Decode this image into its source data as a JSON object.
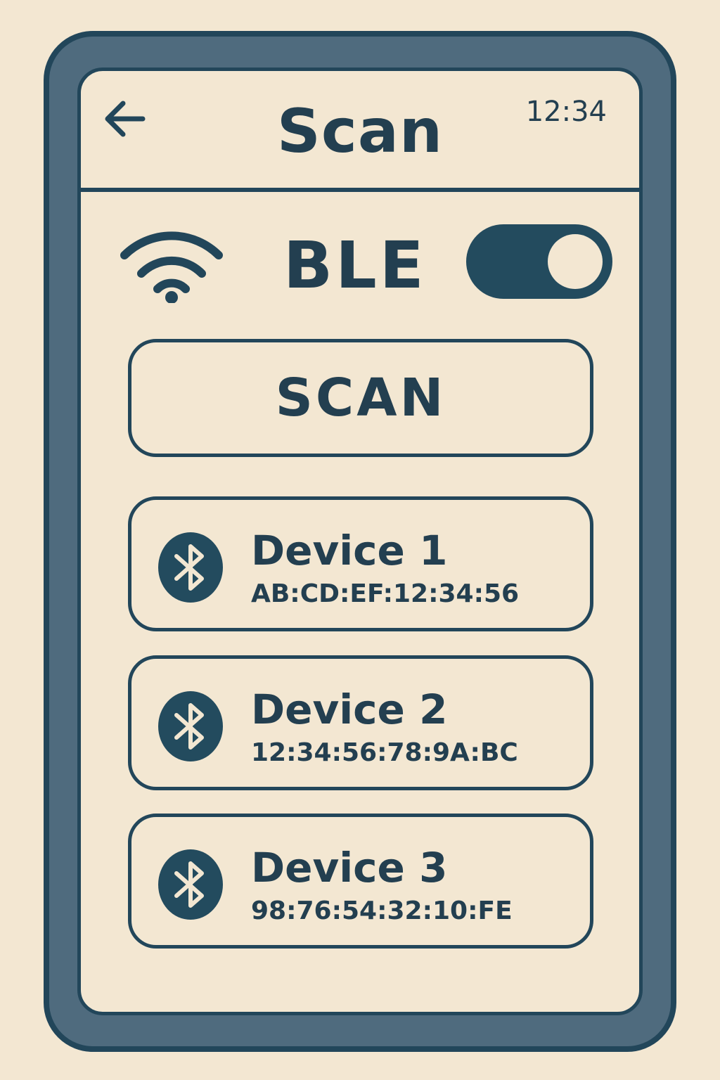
{
  "header": {
    "title": "Scan",
    "time": "12:34",
    "back_icon": "arrow-left-icon"
  },
  "ble": {
    "label": "BLE",
    "toggle_on": true,
    "icon": "wifi-icon"
  },
  "scan_button": {
    "label": "SCAN"
  },
  "devices": [
    {
      "name": "Device 1",
      "address": "AB:CD:EF:12:34:56",
      "icon": "bluetooth-icon"
    },
    {
      "name": "Device 2",
      "address": "12:34:56:78:9A:BC",
      "icon": "bluetooth-icon"
    },
    {
      "name": "Device 3",
      "address": "98:76:54:32:10:FE",
      "icon": "bluetooth-icon"
    }
  ],
  "colors": {
    "background": "#f3e7d2",
    "primary": "#22465a",
    "frame": "#4f6b7e"
  }
}
